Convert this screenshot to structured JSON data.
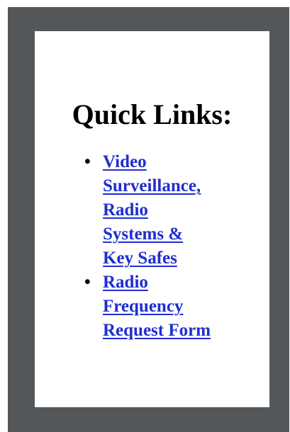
{
  "title": "Quick Links:",
  "links": [
    {
      "lines": [
        "Video",
        "Surveillance,",
        "Radio",
        "Systems &",
        "Key Safes"
      ]
    },
    {
      "lines": [
        "Radio",
        "Frequency",
        "Request Form"
      ]
    }
  ],
  "colors": {
    "frame": "#545759",
    "card": "#ffffff",
    "link": "#1f2ecf",
    "text": "#000000"
  }
}
